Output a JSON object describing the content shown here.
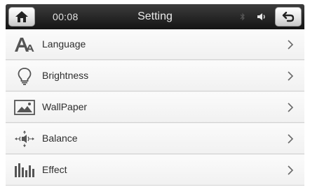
{
  "header": {
    "time": "00:08",
    "title": "Setting",
    "home_icon": "home-icon",
    "back_icon": "back-arrow-icon",
    "bluetooth_icon": "bluetooth-icon",
    "volume_icon": "speaker-icon"
  },
  "menu": {
    "items": [
      {
        "label": "Language",
        "icon": "language-icon"
      },
      {
        "label": "Brightness",
        "icon": "lightbulb-icon"
      },
      {
        "label": "WallPaper",
        "icon": "wallpaper-icon"
      },
      {
        "label": "Balance",
        "icon": "balance-icon"
      },
      {
        "label": "Effect",
        "icon": "equalizer-icon"
      }
    ]
  },
  "colors": {
    "header_bg": "#262626",
    "list_bg": "#f3f3f3",
    "text": "#2e2e2e",
    "icon": "#5a5a5a"
  }
}
